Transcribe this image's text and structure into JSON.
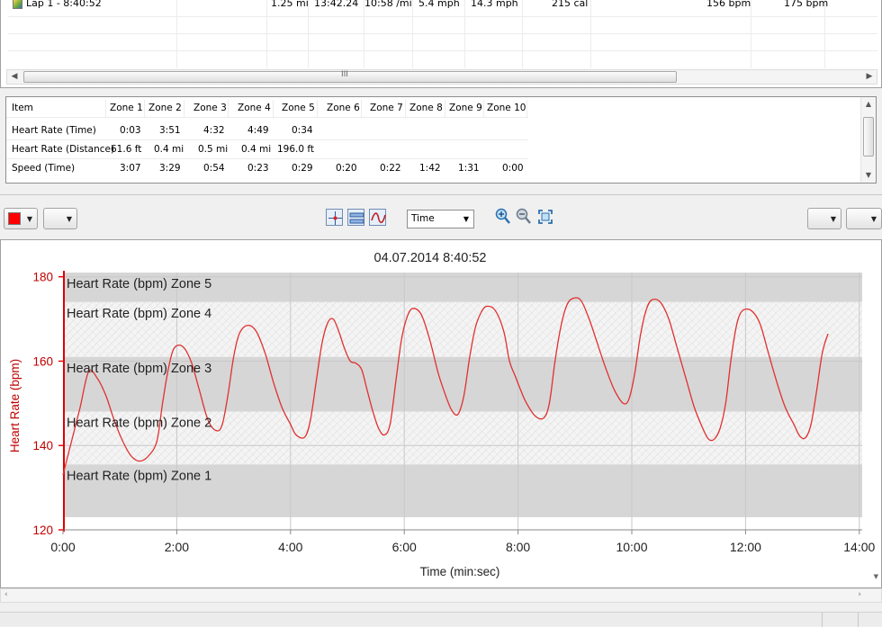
{
  "lap_table": {
    "row": {
      "name": "Lap 1 - 8:40:52",
      "distance": "1.25 mi",
      "duration": "13:42.24",
      "pace": "10:58 /mi",
      "speed": "5.4 mph",
      "max_speed": "14.3 mph",
      "calories": "215 cal",
      "avg_hr": "156 bpm",
      "max_hr": "175 bpm"
    },
    "scroll_grip": "III"
  },
  "zone_table": {
    "headers": [
      "Item",
      "Zone 1",
      "Zone 2",
      "Zone 3",
      "Zone 4",
      "Zone 5",
      "Zone 6",
      "Zone 7",
      "Zone 8",
      "Zone 9",
      "Zone 10"
    ],
    "rows": [
      [
        "Heart Rate (Time)",
        "0:03",
        "3:51",
        "4:32",
        "4:49",
        "0:34",
        "",
        "",
        "",
        "",
        ""
      ],
      [
        "Heart Rate (Distance)",
        "61.6 ft",
        "0.4 mi",
        "0.5 mi",
        "0.4 mi",
        "196.0 ft",
        "",
        "",
        "",
        "",
        ""
      ],
      [
        "Speed (Time)",
        "3:07",
        "3:29",
        "0:54",
        "0:23",
        "0:29",
        "0:20",
        "0:22",
        "1:42",
        "1:31",
        "0:00"
      ]
    ]
  },
  "toolbar": {
    "color_swatch": "#ff0000",
    "axis_select_value": "Time",
    "icons": [
      "crosshair-icon",
      "range-icon",
      "smooth-icon",
      "zoom-in-icon",
      "zoom-out-icon",
      "zoom-fit-icon"
    ]
  },
  "chart_data": {
    "type": "line",
    "title": "04.07.2014 8:40:52",
    "xlabel": "Time (min:sec)",
    "ylabel": "Heart Rate (bpm)",
    "x_unit": "minutes",
    "xlim": [
      0,
      14.3
    ],
    "ylim": [
      120,
      181
    ],
    "x_ticks": [
      "0:00",
      "2:00",
      "4:00",
      "6:00",
      "8:00",
      "10:00",
      "12:00",
      "14:00"
    ],
    "y_ticks": [
      "120",
      "140",
      "160",
      "180"
    ],
    "grid": true,
    "line_color": "#e03030",
    "zones": [
      {
        "label": "Heart Rate (bpm) Zone 5",
        "from": 174,
        "to": 181,
        "style": "solid"
      },
      {
        "label": "Heart Rate (bpm) Zone 4",
        "from": 161,
        "to": 174,
        "style": "hatched"
      },
      {
        "label": "Heart Rate (bpm) Zone 3",
        "from": 148,
        "to": 161,
        "style": "solid"
      },
      {
        "label": "Heart Rate (bpm) Zone 2",
        "from": 135.5,
        "to": 148,
        "style": "hatched"
      },
      {
        "label": "Heart Rate (bpm) Zone 1",
        "from": 123,
        "to": 135.5,
        "style": "solid"
      }
    ],
    "series": [
      {
        "points": [
          [
            0.0,
            133
          ],
          [
            0.15,
            141
          ],
          [
            0.3,
            149
          ],
          [
            0.45,
            157.5
          ],
          [
            0.6,
            156
          ],
          [
            0.75,
            152
          ],
          [
            0.9,
            146
          ],
          [
            1.05,
            141
          ],
          [
            1.2,
            137.5
          ],
          [
            1.35,
            136.3
          ],
          [
            1.5,
            137.5
          ],
          [
            1.65,
            141
          ],
          [
            1.75,
            150
          ],
          [
            1.85,
            158
          ],
          [
            1.95,
            163
          ],
          [
            2.1,
            163.5
          ],
          [
            2.25,
            160
          ],
          [
            2.4,
            153
          ],
          [
            2.55,
            146
          ],
          [
            2.7,
            143.5
          ],
          [
            2.8,
            145
          ],
          [
            2.9,
            152
          ],
          [
            3.0,
            161
          ],
          [
            3.1,
            166.5
          ],
          [
            3.25,
            168.5
          ],
          [
            3.4,
            167
          ],
          [
            3.55,
            162
          ],
          [
            3.7,
            155
          ],
          [
            3.85,
            149
          ],
          [
            4.0,
            145
          ],
          [
            4.1,
            142.5
          ],
          [
            4.25,
            142
          ],
          [
            4.35,
            146
          ],
          [
            4.45,
            155
          ],
          [
            4.55,
            164
          ],
          [
            4.65,
            169
          ],
          [
            4.75,
            170
          ],
          [
            4.85,
            167
          ],
          [
            4.95,
            163
          ],
          [
            5.05,
            160
          ],
          [
            5.15,
            159.5
          ],
          [
            5.25,
            158
          ],
          [
            5.35,
            153
          ],
          [
            5.45,
            148
          ],
          [
            5.55,
            144
          ],
          [
            5.65,
            142.5
          ],
          [
            5.75,
            145
          ],
          [
            5.85,
            155
          ],
          [
            5.95,
            165
          ],
          [
            6.05,
            170.5
          ],
          [
            6.15,
            172.5
          ],
          [
            6.3,
            171
          ],
          [
            6.45,
            165
          ],
          [
            6.6,
            157
          ],
          [
            6.75,
            151
          ],
          [
            6.85,
            148
          ],
          [
            6.95,
            147.5
          ],
          [
            7.05,
            152
          ],
          [
            7.15,
            161
          ],
          [
            7.25,
            168
          ],
          [
            7.35,
            171.5
          ],
          [
            7.45,
            173
          ],
          [
            7.6,
            172
          ],
          [
            7.75,
            167
          ],
          [
            7.85,
            160
          ],
          [
            7.95,
            156.5
          ],
          [
            8.05,
            153
          ],
          [
            8.15,
            150
          ],
          [
            8.3,
            147
          ],
          [
            8.45,
            146.5
          ],
          [
            8.55,
            150
          ],
          [
            8.65,
            160
          ],
          [
            8.75,
            168
          ],
          [
            8.85,
            173
          ],
          [
            8.95,
            174.8
          ],
          [
            9.1,
            174.5
          ],
          [
            9.25,
            170
          ],
          [
            9.4,
            164
          ],
          [
            9.55,
            158
          ],
          [
            9.7,
            153
          ],
          [
            9.85,
            150
          ],
          [
            9.95,
            151
          ],
          [
            10.05,
            157
          ],
          [
            10.15,
            166
          ],
          [
            10.25,
            172
          ],
          [
            10.35,
            174.5
          ],
          [
            10.5,
            174
          ],
          [
            10.65,
            170
          ],
          [
            10.8,
            163
          ],
          [
            10.95,
            156
          ],
          [
            11.1,
            149
          ],
          [
            11.25,
            144
          ],
          [
            11.35,
            141.5
          ],
          [
            11.45,
            141.5
          ],
          [
            11.55,
            144
          ],
          [
            11.65,
            150
          ],
          [
            11.75,
            161
          ],
          [
            11.85,
            169
          ],
          [
            11.95,
            172
          ],
          [
            12.1,
            172
          ],
          [
            12.25,
            169
          ],
          [
            12.4,
            162
          ],
          [
            12.55,
            155
          ],
          [
            12.7,
            149
          ],
          [
            12.85,
            145
          ],
          [
            12.95,
            142.3
          ],
          [
            13.05,
            141.8
          ],
          [
            13.15,
            145
          ],
          [
            13.25,
            153
          ],
          [
            13.35,
            162
          ],
          [
            13.45,
            166.5
          ]
        ]
      }
    ]
  }
}
